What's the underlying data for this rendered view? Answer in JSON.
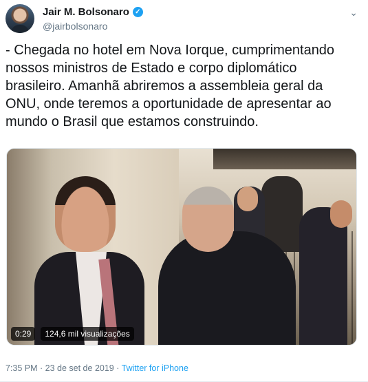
{
  "author": {
    "name": "Jair M. Bolsonaro",
    "handle": "@jairbolsonaro",
    "verified_icon": "✓"
  },
  "menu_icon": "chevron-down-icon",
  "tweet": {
    "text": "- Chegada no hotel em Nova Iorque, cumprimentando nossos ministros de Estado e corpo diplomático brasileiro. Amanhã abriremos a assembleia geral da ONU, onde teremos a oportunidade de apresentar ao mundo o Brasil que estamos construindo."
  },
  "video": {
    "duration": "0:29",
    "views": "124,6 mil visualizações"
  },
  "footer": {
    "timestamp": "7:35 PM · 23 de set de 2019 · ",
    "source": "Twitter for iPhone"
  },
  "colors": {
    "accent": "#1da1f2",
    "muted": "#657786",
    "text": "#14171a"
  }
}
